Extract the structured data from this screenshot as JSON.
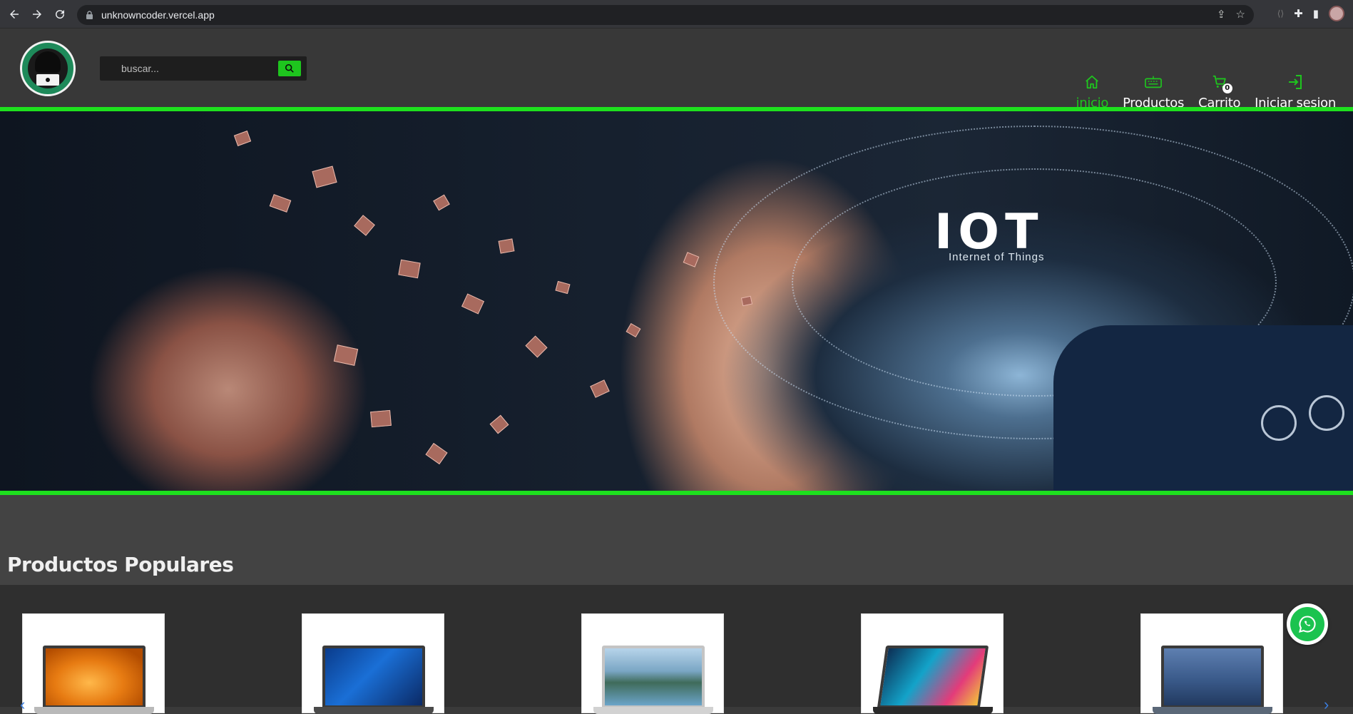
{
  "browser": {
    "url": "unknowncoder.vercel.app",
    "icons": [
      "back-icon",
      "forward-icon",
      "reload-icon",
      "lock-icon",
      "share-icon",
      "bookmark-star-icon",
      "extension-icon",
      "puzzle-icon",
      "sidepanel-icon",
      "profile-avatar"
    ]
  },
  "header": {
    "search": {
      "placeholder": "buscar..."
    },
    "nav": [
      {
        "label": "inicio",
        "icon": "home-icon",
        "active": true
      },
      {
        "label": "Productos",
        "icon": "keyboard-icon",
        "active": false
      },
      {
        "label": "Carrito",
        "icon": "cart-icon",
        "active": false,
        "badge": "0"
      },
      {
        "label": "Iniciar sesion",
        "icon": "login-icon",
        "active": false
      }
    ]
  },
  "hero": {
    "iot_text": "IOT",
    "iot_sub": "Internet of Things"
  },
  "popular": {
    "title": "Productos Populares",
    "products": [
      {
        "image": "laptop-orange-flower"
      },
      {
        "image": "laptop-windows"
      },
      {
        "image": "laptop-mountain-lake"
      },
      {
        "image": "laptop-colorful"
      },
      {
        "image": "laptop-blue-ocean"
      }
    ]
  },
  "colors": {
    "accent": "#1ee01e",
    "header_bg": "#383838",
    "whatsapp": "#1bc34f"
  }
}
